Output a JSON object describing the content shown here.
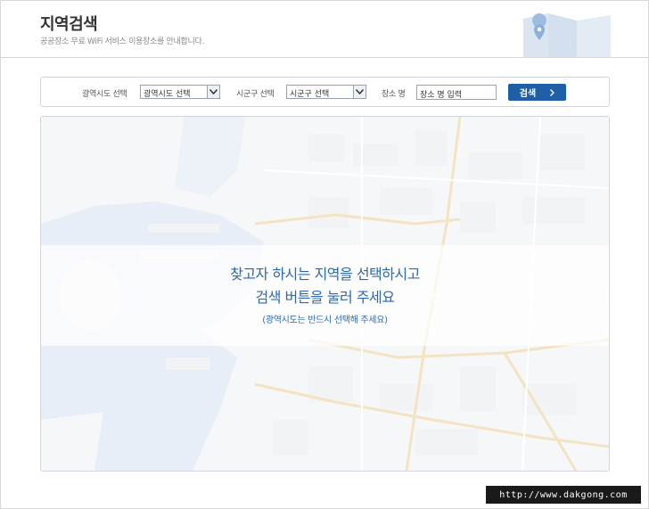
{
  "header": {
    "title": "지역검색",
    "subtitle": "공공장소 무료 WiFi 서비스 이용장소를 안내합니다."
  },
  "search": {
    "province_label": "광역시도 선택",
    "province_value": "광역시도 선택",
    "district_label": "시군구 선택",
    "district_value": "시군구 선택",
    "place_label": "장소 명",
    "place_value": "장소 명 입력",
    "button_label": "검색"
  },
  "map": {
    "message_line1": "찾고자 하시는 지역을 선택하시고",
    "message_line2": "검색 버튼을 눌러 주세요",
    "message_note": "(광역시도는 반드시 선택해 주세요)"
  },
  "watermark": "http://www.dakgong.com",
  "colors": {
    "accent": "#1f5fa8",
    "message": "#2a69b0",
    "water": "#c9d9ee",
    "road": "#e6c27a"
  },
  "icons": {
    "dropdown": "chevron-down-icon",
    "button": "chevron-right-icon",
    "header": "map-pin-icon"
  }
}
